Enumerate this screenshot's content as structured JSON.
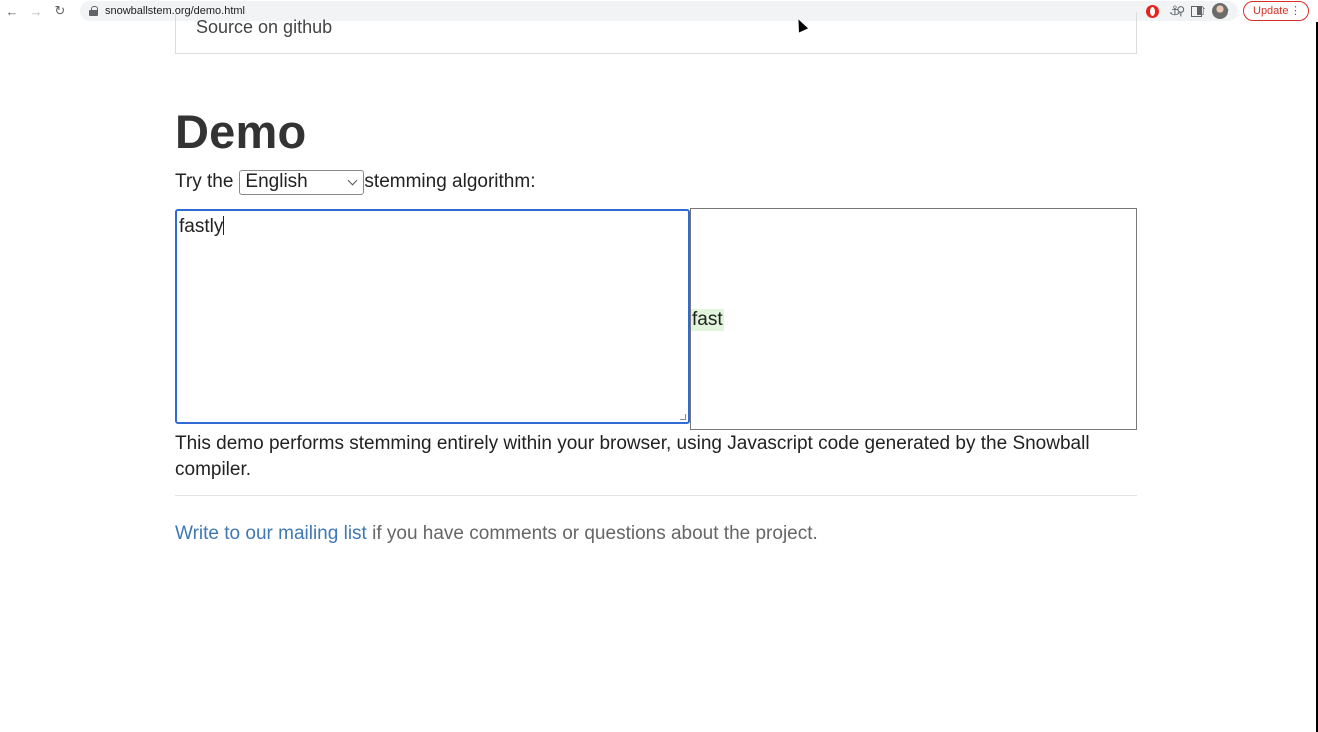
{
  "browser": {
    "url": "snowballstem.org/demo.html",
    "update_label": "Update"
  },
  "page": {
    "source_link": "Source on github",
    "title": "Demo",
    "try_prefix": "Try the",
    "selected_language": "English",
    "try_suffix": "stemming algorithm:",
    "input_text": "fastly",
    "output_stem": "fast",
    "description": "This demo performs stemming entirely within your browser, using Javascript code generated by the Snowball compiler.",
    "footer_link": "Write to our mailing list",
    "footer_text": " if you have comments or questions about the project."
  },
  "colors": {
    "link": "#3f78b5",
    "focus_border": "#2f6bd3",
    "stem_highlight": "#e0f5dc",
    "update_accent": "#d93025"
  }
}
